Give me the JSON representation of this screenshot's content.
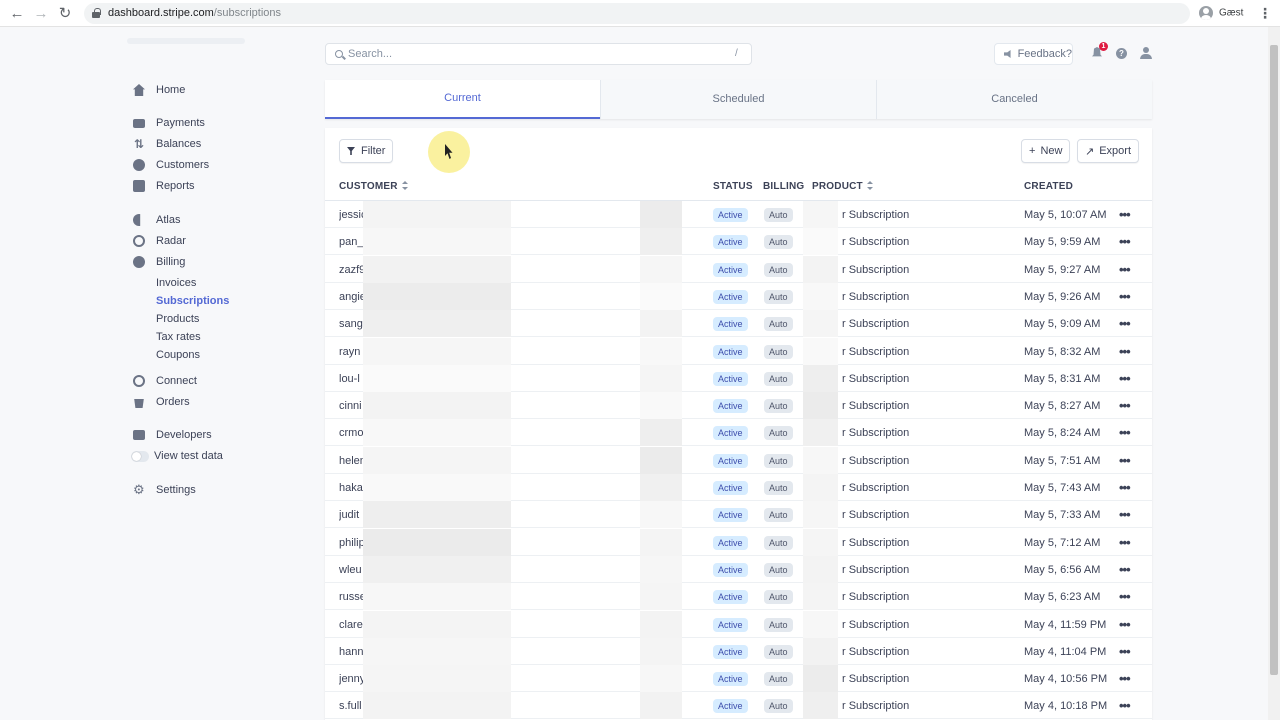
{
  "browser": {
    "url_host": "dashboard.stripe.com",
    "url_path": "/subscriptions",
    "profile_label": "Gæst"
  },
  "sidebar": {
    "items": [
      {
        "label": "Home",
        "icon": "home-icon"
      },
      {
        "label": "Payments",
        "icon": "card-icon"
      },
      {
        "label": "Balances",
        "icon": "balance-icon"
      },
      {
        "label": "Customers",
        "icon": "user-icon"
      },
      {
        "label": "Reports",
        "icon": "report-icon"
      },
      {
        "label": "Atlas",
        "icon": "atlas-icon"
      },
      {
        "label": "Radar",
        "icon": "radar-icon"
      },
      {
        "label": "Billing",
        "icon": "billing-icon"
      },
      {
        "label": "Connect",
        "icon": "connect-icon"
      },
      {
        "label": "Orders",
        "icon": "orders-icon"
      },
      {
        "label": "Developers",
        "icon": "developers-icon"
      },
      {
        "label": "View test data",
        "icon": "toggle"
      },
      {
        "label": "Settings",
        "icon": "gear-icon"
      }
    ],
    "billing_sub": [
      "Invoices",
      "Subscriptions",
      "Products",
      "Tax rates",
      "Coupons"
    ],
    "active_sub": "Subscriptions"
  },
  "search": {
    "placeholder": "Search...",
    "shortcut": "/"
  },
  "topbar": {
    "feedback_label": "Feedback?",
    "notification_count": "1",
    "help": "?"
  },
  "tabs": [
    {
      "label": "Current",
      "active": true
    },
    {
      "label": "Scheduled",
      "active": false
    },
    {
      "label": "Canceled",
      "active": false
    }
  ],
  "toolbar": {
    "filter_label": "Filter",
    "new_label": "New",
    "export_label": "Export"
  },
  "table": {
    "headers": {
      "customer": "CUSTOMER",
      "status": "STATUS",
      "billing": "BILLING",
      "product": "PRODUCT",
      "created": "CREATED"
    },
    "rows": [
      {
        "customer": "jessic",
        "status": "Active",
        "billing": "Auto",
        "product": "r Subscription",
        "created": "May 5, 10:07 AM"
      },
      {
        "customer": "pan_l",
        "status": "Active",
        "billing": "Auto",
        "product": "r Subscription",
        "created": "May 5, 9:59 AM"
      },
      {
        "customer": "zazf9",
        "status": "Active",
        "billing": "Auto",
        "product": "r Subscription",
        "created": "May 5, 9:27 AM"
      },
      {
        "customer": "angie",
        "status": "Active",
        "billing": "Auto",
        "product": "r Subscription",
        "created": "May 5, 9:26 AM"
      },
      {
        "customer": "sang",
        "status": "Active",
        "billing": "Auto",
        "product": "r Subscription",
        "created": "May 5, 9:09 AM"
      },
      {
        "customer": "rayn",
        "status": "Active",
        "billing": "Auto",
        "product": "r Subscription",
        "created": "May 5, 8:32 AM"
      },
      {
        "customer": "lou-l",
        "status": "Active",
        "billing": "Auto",
        "product": "r Subscription",
        "created": "May 5, 8:31 AM"
      },
      {
        "customer": "cinni",
        "status": "Active",
        "billing": "Auto",
        "product": "r Subscription",
        "created": "May 5, 8:27 AM"
      },
      {
        "customer": "crmo",
        "status": "Active",
        "billing": "Auto",
        "product": "r Subscription",
        "created": "May 5, 8:24 AM"
      },
      {
        "customer": "helen",
        "status": "Active",
        "billing": "Auto",
        "product": "r Subscription",
        "created": "May 5, 7:51 AM"
      },
      {
        "customer": "haka",
        "status": "Active",
        "billing": "Auto",
        "product": "r Subscription",
        "created": "May 5, 7:43 AM"
      },
      {
        "customer": "judit",
        "status": "Active",
        "billing": "Auto",
        "product": "r Subscription",
        "created": "May 5, 7:33 AM"
      },
      {
        "customer": "philip",
        "status": "Active",
        "billing": "Auto",
        "product": "r Subscription",
        "created": "May 5, 7:12 AM"
      },
      {
        "customer": "wleu",
        "status": "Active",
        "billing": "Auto",
        "product": "r Subscription",
        "created": "May 5, 6:56 AM"
      },
      {
        "customer": "russe",
        "status": "Active",
        "billing": "Auto",
        "product": "r Subscription",
        "created": "May 5, 6:23 AM"
      },
      {
        "customer": "clare",
        "status": "Active",
        "billing": "Auto",
        "product": "r Subscription",
        "created": "May 4, 11:59 PM"
      },
      {
        "customer": "hann",
        "status": "Active",
        "billing": "Auto",
        "product": "r Subscription",
        "created": "May 4, 11:04 PM"
      },
      {
        "customer": "jenny",
        "status": "Active",
        "billing": "Auto",
        "product": "r Subscription",
        "created": "May 4, 10:56 PM"
      },
      {
        "customer": "s.full",
        "status": "Active",
        "billing": "Auto",
        "product": "r Subscription",
        "created": "May 4, 10:18 PM"
      }
    ]
  },
  "colors": {
    "accent": "#5469d4",
    "active_badge_bg": "#d6ecff",
    "cursor_highlight": "#f5e650"
  }
}
